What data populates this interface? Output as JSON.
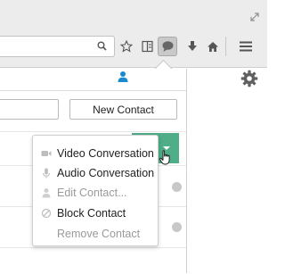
{
  "contacts_panel": {
    "new_contact_label": "New Contact"
  },
  "context_menu": {
    "items": [
      {
        "label": "Video Conversation",
        "icon": "video-icon",
        "enabled": true
      },
      {
        "label": "Audio Conversation",
        "icon": "microphone-icon",
        "enabled": true
      },
      {
        "label": "Edit Contact...",
        "icon": "person-icon",
        "enabled": false
      },
      {
        "label": "Block Contact",
        "icon": "block-icon",
        "enabled": true
      },
      {
        "label": "Remove Contact",
        "icon": "",
        "enabled": false
      }
    ]
  },
  "colors": {
    "accent_green": "#4fad87",
    "contacts_tab_blue": "#1a8ad0"
  }
}
